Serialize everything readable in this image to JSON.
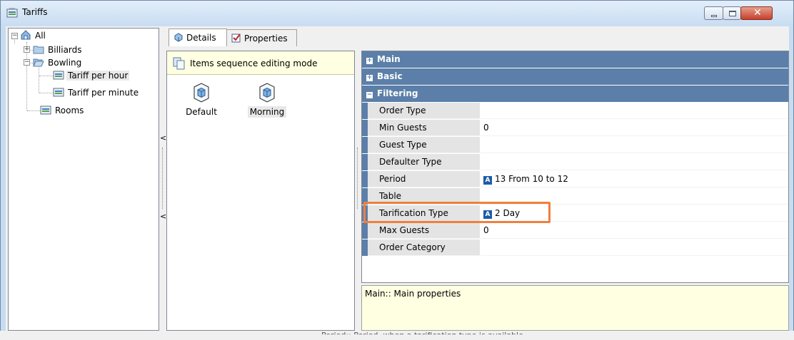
{
  "window": {
    "title": "Tariffs"
  },
  "tree": {
    "root": "All",
    "nodes": [
      {
        "label": "Billiards"
      },
      {
        "label": "Bowling"
      },
      {
        "label": "Tariff per hour"
      },
      {
        "label": "Tariff per minute"
      },
      {
        "label": "Rooms"
      }
    ]
  },
  "tabs": [
    {
      "label": "Details"
    },
    {
      "label": "Properties"
    }
  ],
  "sequence_bar": {
    "text": "Items sequence editing mode"
  },
  "items": [
    {
      "label": "Default"
    },
    {
      "label": "Morning"
    }
  ],
  "property_grid": {
    "categories": [
      {
        "label": "Main",
        "state": "+"
      },
      {
        "label": "Basic",
        "state": "+"
      },
      {
        "label": "Filtering",
        "state": "−"
      }
    ],
    "rows": [
      {
        "name": "Order Type",
        "value": ""
      },
      {
        "name": "Min Guests",
        "value": "0"
      },
      {
        "name": "Guest Type",
        "value": ""
      },
      {
        "name": "Defaulter Type",
        "value": ""
      },
      {
        "name": "Period",
        "value": "13 From 10 to 12",
        "badge": "A"
      },
      {
        "name": "Table",
        "value": ""
      },
      {
        "name": "Tarification Type",
        "value": "2 Day",
        "badge": "A"
      },
      {
        "name": "Max Guests",
        "value": "0"
      },
      {
        "name": "Order Category",
        "value": ""
      }
    ]
  },
  "description": {
    "text": "Main:: Main properties"
  },
  "truncated_footer": {
    "text": "Period:: Period, when a tarification type is available"
  },
  "colors": {
    "category_header": "#5b7fa8",
    "highlight": "#f0803c",
    "tooltip_bg": "#ffffe1"
  }
}
